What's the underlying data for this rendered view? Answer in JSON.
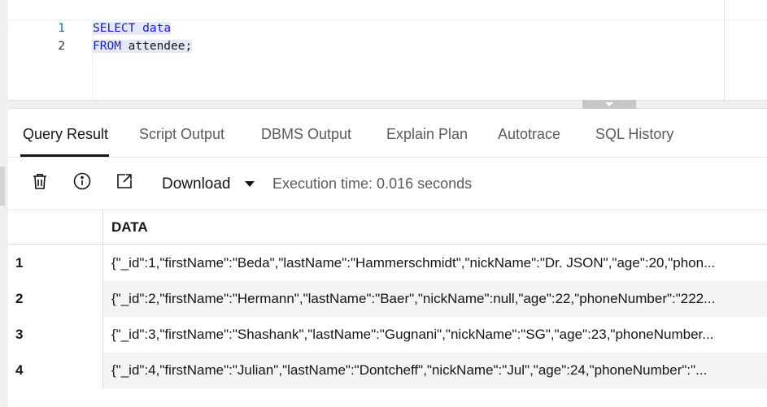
{
  "editor": {
    "lines": [
      {
        "number": "1",
        "keyword": "SELECT",
        "rest": "data"
      },
      {
        "number": "2",
        "keyword": "FROM",
        "rest": "attendee;"
      }
    ]
  },
  "tabs": [
    {
      "label": "Query Result",
      "active": true
    },
    {
      "label": "Script Output",
      "active": false
    },
    {
      "label": "DBMS Output",
      "active": false
    },
    {
      "label": "Explain Plan",
      "active": false
    },
    {
      "label": "Autotrace",
      "active": false
    },
    {
      "label": "SQL History",
      "active": false
    }
  ],
  "toolbar": {
    "icons": [
      "trash-icon",
      "info-icon",
      "open-external-icon"
    ],
    "download_label": "Download",
    "execution_time": "Execution time: 0.016 seconds"
  },
  "grid": {
    "column_header": "DATA",
    "rows": [
      {
        "num": "1",
        "data": "{\"_id\":1,\"firstName\":\"Beda\",\"lastName\":\"Hammerschmidt\",\"nickName\":\"Dr. JSON\",\"age\":20,\"phon..."
      },
      {
        "num": "2",
        "data": "{\"_id\":2,\"firstName\":\"Hermann\",\"lastName\":\"Baer\",\"nickName\":null,\"age\":22,\"phoneNumber\":\"222..."
      },
      {
        "num": "3",
        "data": "{\"_id\":3,\"firstName\":\"Shashank\",\"lastName\":\"Gugnani\",\"nickName\":\"SG\",\"age\":23,\"phoneNumber..."
      },
      {
        "num": "4",
        "data": "{\"_id\":4,\"firstName\":\"Julian\",\"lastName\":\"Dontcheff\",\"nickName\":\"Jul\",\"age\":24,\"phoneNumber\":\"..."
      }
    ]
  },
  "colors": {
    "keyword": "#1a1adf",
    "selection": "#e5e9f6",
    "row_alt": "#f5f4f2",
    "text": "#161513"
  }
}
